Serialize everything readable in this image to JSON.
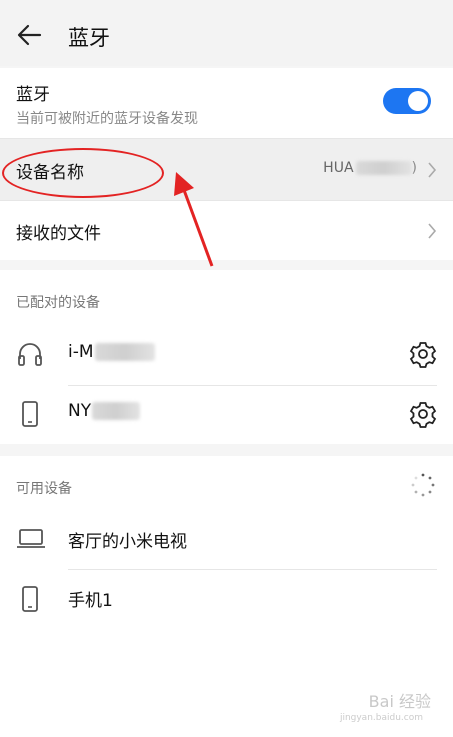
{
  "header": {
    "title": "蓝牙",
    "back_icon": "arrow-left-icon"
  },
  "bluetooth": {
    "label": "蓝牙",
    "subtitle": "当前可被附近的蓝牙设备发现",
    "enabled": true,
    "accent": "#1d76f2"
  },
  "device_name": {
    "label": "设备名称",
    "value": "HUA"
  },
  "received_files": {
    "label": "接收的文件"
  },
  "paired": {
    "title": "已配对的设备",
    "devices": [
      {
        "name": "i-M",
        "icon": "headphones-icon"
      },
      {
        "name": "NY",
        "icon": "phone-icon"
      }
    ]
  },
  "available": {
    "title": "可用设备",
    "devices": [
      {
        "name": "客厅的小米电视",
        "icon": "laptop-icon"
      },
      {
        "name": "手机1",
        "icon": "phone-icon"
      }
    ]
  },
  "annotation": {
    "color": "#e32323"
  },
  "watermark": {
    "text": "Bai 经验",
    "small": "jingyan.baidu.com"
  }
}
